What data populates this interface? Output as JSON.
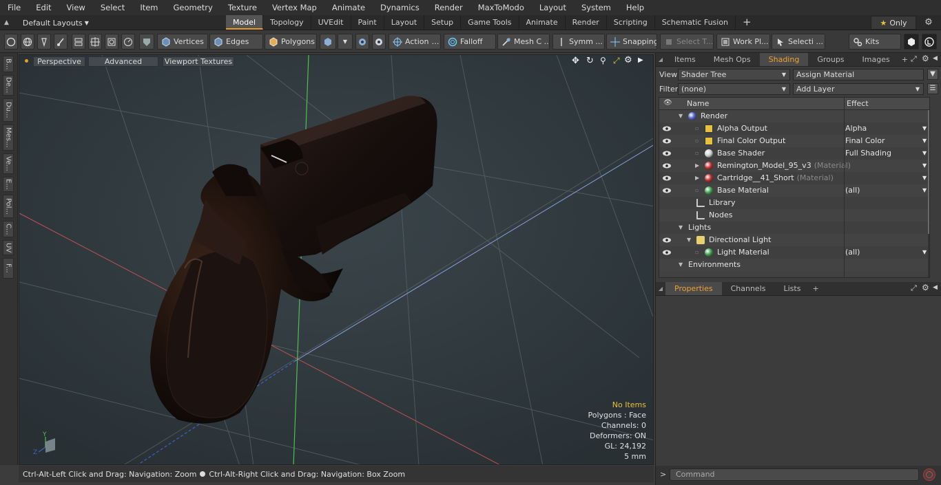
{
  "menu": [
    "File",
    "Edit",
    "View",
    "Select",
    "Item",
    "Geometry",
    "Texture",
    "Vertex Map",
    "Animate",
    "Dynamics",
    "Render",
    "MaxToModo",
    "Layout",
    "System",
    "Help"
  ],
  "layout": {
    "selector_label": "Default Layouts",
    "tabs": [
      "Model",
      "Topology",
      "UVEdit",
      "Paint",
      "Layout",
      "Setup",
      "Game Tools",
      "Animate",
      "Render",
      "Scripting",
      "Schematic Fusion"
    ],
    "active_tab": "Model",
    "add_label": "+",
    "only_label": "Only",
    "accent_color": "#e8a020"
  },
  "toolbar": {
    "vertices": "Vertices",
    "edges": "Edges",
    "polygons": "Polygons",
    "action": "Action",
    "falloff": "Falloff",
    "mesh": "Mesh C ...",
    "symm": "Symm ...",
    "snapping": "Snapping",
    "select_t": "Select T...",
    "work_plane": "Work Pl...",
    "selecti": "Selecti ...",
    "kits": "Kits"
  },
  "left_strip": [
    "B...",
    "De...",
    "Du...",
    "Mes...",
    "Ve...",
    "E...",
    "Pol...",
    "C...",
    "UV",
    "F..."
  ],
  "viewport": {
    "perspective": "Perspective",
    "advanced": "Advanced",
    "textures": "Viewport Textures",
    "info": {
      "items": "No Items",
      "polygons": "Polygons : Face",
      "channels": "Channels: 0",
      "deformers": "Deformers: ON",
      "gl": "GL: 24,192",
      "scale": "5 mm"
    },
    "axis_labels": {
      "y": "Y",
      "z": "Z"
    }
  },
  "status": {
    "left": "Ctrl-Alt-Left Click and Drag: Navigation: Zoom",
    "right": "Ctrl-Alt-Right Click and Drag: Navigation: Box Zoom"
  },
  "shader_panel": {
    "tabs": [
      "Items",
      "Mesh Ops",
      "Shading",
      "Groups",
      "Images"
    ],
    "active_tab": "Shading",
    "view_label": "View",
    "view_value": "Shader Tree",
    "assign_material": "Assign Material",
    "filter_label": "Filter",
    "filter_value": "(none)",
    "add_layer": "Add Layer",
    "col_name": "Name",
    "col_effect": "Effect",
    "rows": [
      {
        "name": "Render",
        "sub": "",
        "effect": "",
        "eye": false,
        "indent": 0,
        "expand": "open",
        "ball": "#5060c0"
      },
      {
        "name": "Alpha Output",
        "sub": "",
        "effect": "Alpha",
        "eye": true,
        "indent": 2,
        "expand": "",
        "ball": "output"
      },
      {
        "name": "Final Color Output",
        "sub": "",
        "effect": "Final Color",
        "eye": true,
        "indent": 2,
        "expand": "",
        "ball": "output"
      },
      {
        "name": "Base Shader",
        "sub": "",
        "effect": "Full Shading",
        "eye": true,
        "indent": 2,
        "expand": "",
        "ball": "#d0d0d0"
      },
      {
        "name": "Remington_Model_95_v3",
        "sub": "(Material)",
        "effect": "",
        "eye": true,
        "indent": 2,
        "expand": "closed",
        "ball": "#c03030"
      },
      {
        "name": "Cartridge__41_Short",
        "sub": "(Material)",
        "effect": "",
        "eye": true,
        "indent": 2,
        "expand": "closed",
        "ball": "#c03030"
      },
      {
        "name": "Base Material",
        "sub": "",
        "effect": "(all)",
        "eye": true,
        "indent": 2,
        "expand": "",
        "ball": "#40a050"
      },
      {
        "name": "Library",
        "sub": "",
        "effect": "",
        "eye": false,
        "indent": 1,
        "expand": "",
        "ball": "folder"
      },
      {
        "name": "Nodes",
        "sub": "",
        "effect": "",
        "eye": false,
        "indent": 1,
        "expand": "",
        "ball": "folder"
      },
      {
        "name": "Lights",
        "sub": "",
        "effect": "",
        "eye": false,
        "indent": 0,
        "expand": "open",
        "ball": ""
      },
      {
        "name": "Directional Light",
        "sub": "",
        "effect": "",
        "eye": true,
        "indent": 1,
        "expand": "open",
        "ball": "light"
      },
      {
        "name": "Light Material",
        "sub": "",
        "effect": "(all)",
        "eye": true,
        "indent": 2,
        "expand": "",
        "ball": "#40a050"
      },
      {
        "name": "Environments",
        "sub": "",
        "effect": "",
        "eye": false,
        "indent": 0,
        "expand": "open",
        "ball": ""
      }
    ]
  },
  "properties_panel": {
    "tabs": [
      "Properties",
      "Channels",
      "Lists"
    ],
    "active_tab": "Properties",
    "add_label": "+"
  },
  "command": {
    "prompt": ">",
    "placeholder": "Command"
  }
}
